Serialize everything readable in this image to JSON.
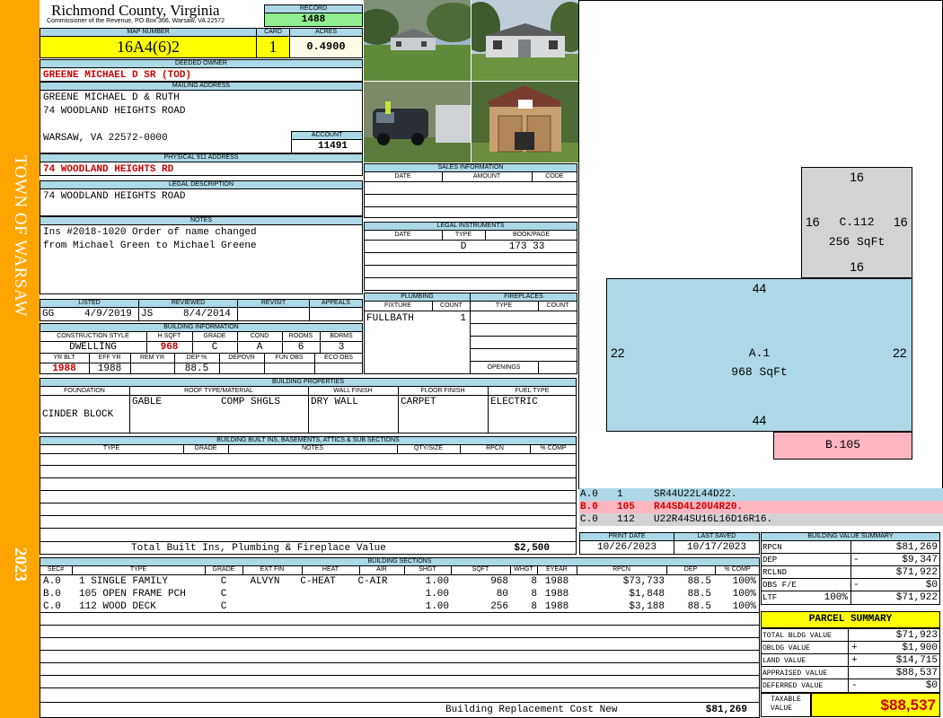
{
  "side": {
    "town": "TOWN OF WARSAW",
    "year": "2023",
    "color": "#ffa500"
  },
  "header": {
    "county": "Richmond County, Virginia",
    "commissioner": "Commissioner of the Revenue, PO Box 366, Warsaw, VA 22572"
  },
  "record": {
    "label": "RECORD",
    "value": "1488"
  },
  "map_number": {
    "label": "MAP NUMBER",
    "value": "16A4(6)2"
  },
  "card": {
    "label": "CARD",
    "value": "1"
  },
  "acres": {
    "label": "ACRES",
    "value": "0.4900"
  },
  "deeded_owner": {
    "label": "DEEDED OWNER",
    "value": "GREENE MICHAEL D SR (TOD)"
  },
  "mailing": {
    "label": "MAILING ADDRESS",
    "line1": "GREENE MICHAEL D & RUTH",
    "line2": "74 WOODLAND HEIGHTS ROAD",
    "line3": "WARSAW, VA 22572-0000"
  },
  "account": {
    "label": "ACCOUNT",
    "value": "11491"
  },
  "physical": {
    "label": "PHYSICAL 911 ADDRESS",
    "value": "74 WOODLAND HEIGHTS RD"
  },
  "legal": {
    "label": "LEGAL DESCRIPTION",
    "value": "74 WOODLAND HEIGHTS ROAD"
  },
  "notes": {
    "label": "NOTES",
    "line1": "Ins #2018-1020 Order of name changed",
    "line2": "from Michael Green to Michael Greene"
  },
  "sales": {
    "label": "SALES INFORMATION",
    "cols": [
      "DATE",
      "AMOUNT",
      "CODE"
    ]
  },
  "instruments": {
    "label": "LEGAL INSTRUMENTS",
    "cols": [
      "DATE",
      "TYPE",
      "BOOK/PAGE"
    ],
    "row_type": "D",
    "row_book": "173 33"
  },
  "listed": {
    "label": "LISTED",
    "by": "GG",
    "date": "4/9/2019"
  },
  "reviewed": {
    "label": "REVIEWED",
    "by": "JS",
    "date": "8/4/2014"
  },
  "revisit": {
    "label": "REVISIT"
  },
  "appeals": {
    "label": "APPEALS"
  },
  "building_info": {
    "label": "BUILDING INFORMATION",
    "h1": [
      "CONSTRUCTION STYLE",
      "H SQFT",
      "GRADE",
      "COND",
      "ROOMS",
      "BDRMS"
    ],
    "v1": [
      "DWELLING",
      "968",
      "C",
      "A",
      "6",
      "3"
    ],
    "h2": [
      "YR BLT",
      "EFF YR",
      "REM YR",
      "DEP %",
      "DEPOVR",
      "FUN OBS",
      "ECO OBS"
    ],
    "v2": [
      "1988",
      "1988",
      "",
      "88.5",
      "",
      "",
      ""
    ]
  },
  "plumbing": {
    "label": "PLUMBING",
    "cols": [
      "FIXTURE",
      "COUNT"
    ],
    "fixture": "FULLBATH",
    "count": "1"
  },
  "fireplaces": {
    "label": "FIREPLACES",
    "cols": [
      "TYPE",
      "COUNT"
    ],
    "openings": "OPENINGS"
  },
  "properties": {
    "label": "BUILDING PROPERTIES",
    "cols": [
      "FOUNDATION",
      "ROOF TYPE/MATERIAL",
      "WALL FINISH",
      "FLOOR FINISH",
      "FUEL TYPE"
    ],
    "foundation": "CINDER BLOCK",
    "roof_type": "GABLE",
    "roof_material": "COMP SHGLS",
    "wall": "DRY WALL",
    "floor": "CARPET",
    "fuel": "ELECTRIC"
  },
  "builtins": {
    "label": "BUILDING BUILT INS, BASEMENTS, ATTICS & SUB SECTIONS",
    "cols": [
      "TYPE",
      "GRADE",
      "NOTES",
      "QTY/SIZE",
      "RPCN",
      "% COMP"
    ],
    "total_label": "Total Built Ins, Plumbing & Fireplace Value",
    "total_value": "$2,500"
  },
  "dates": {
    "print_label": "PRINT DATE",
    "print": "10/26/2023",
    "saved_label": "LAST SAVED",
    "saved": "10/17/2023"
  },
  "sections": {
    "label": "BUILDING SECTIONS",
    "cols": [
      "SEC#",
      "TYPE",
      "GRADE",
      "EXT FIN",
      "HEAT",
      "AIR",
      "SHGT",
      "SQFT",
      "WHGT",
      "EYEAR",
      "RPCN",
      "DEP",
      "% COMP"
    ],
    "rows": [
      {
        "sec": "A.0",
        "type": "1 SINGLE FAMILY",
        "grade": "C",
        "ext": "ALVYN",
        "heat": "C-HEAT",
        "air": "C-AIR",
        "shgt": "1.00",
        "sqft": "968",
        "whgt": "8",
        "eyear": "1988",
        "rpcn": "$73,733",
        "dep": "88.5",
        "comp": "100%"
      },
      {
        "sec": "B.0",
        "type": "105 OPEN FRAME PCH",
        "grade": "C",
        "ext": "",
        "heat": "",
        "air": "",
        "shgt": "1.00",
        "sqft": "80",
        "whgt": "8",
        "eyear": "1988",
        "rpcn": "$1,848",
        "dep": "88.5",
        "comp": "100%"
      },
      {
        "sec": "C.0",
        "type": "112 WOOD DECK",
        "grade": "C",
        "ext": "",
        "heat": "",
        "air": "",
        "shgt": "1.00",
        "sqft": "256",
        "whgt": "8",
        "eyear": "1988",
        "rpcn": "$3,188",
        "dep": "88.5",
        "comp": "100%"
      }
    ],
    "total_label": "Building Replacement Cost New",
    "total_value": "$81,269"
  },
  "sketch": {
    "c": {
      "top": "16",
      "left": "16",
      "right": "16",
      "bottom": "16",
      "name": "C.112",
      "area": "256 SqFt",
      "color": "#d3d3d3"
    },
    "a": {
      "top": "44",
      "left": "22",
      "right": "22",
      "bottom": "44",
      "name": "A.1",
      "area": "968 SqFt",
      "color": "#add8e6"
    },
    "b": {
      "name": "B.105",
      "color": "#ffb6c1"
    }
  },
  "sketch_legend": [
    {
      "sec": "A.0",
      "code": "1",
      "path": "SR44U22L44D22.",
      "color": "#add8e6"
    },
    {
      "sec": "B.0",
      "code": "105",
      "path": "R44SD4L20U4R20.",
      "color": "#ffb6c1"
    },
    {
      "sec": "C.0",
      "code": "112",
      "path": "U22R44SU16L16D16R16.",
      "color": "#d3d3d3"
    }
  ],
  "value_summary": {
    "label": "BUILDING VALUE SUMMARY",
    "rpcn_label": "RPCN",
    "rpcn": "$81,269",
    "dep_label": "DEP",
    "dep_sign": "-",
    "dep": "$9,347",
    "rclnd_label": "RCLND",
    "rclnd": "$71,922",
    "obs_label": "OBS F/E",
    "obs_sign": "-",
    "obs": "$0",
    "ltf_label": "LTF",
    "ltf_pct": "100%",
    "ltf": "$71,922"
  },
  "parcel": {
    "label": "PARCEL SUMMARY",
    "bldg_label": "TOTAL BLDG VALUE",
    "bldg": "$71,923",
    "obldg_label": "OBLDG VALUE",
    "obldg_sign": "+",
    "obldg": "$1,900",
    "land_label": "LAND VALUE",
    "land_sign": "+",
    "land": "$14,715",
    "appraised_label": "APPRAISED VALUE",
    "appraised": "$88,537",
    "deferred_label": "DEFERRED VALUE",
    "deferred_sign": "-",
    "deferred": "$0",
    "taxable_label1": "TAXABLE",
    "taxable_label2": "VALUE",
    "taxable": "$88,537"
  }
}
